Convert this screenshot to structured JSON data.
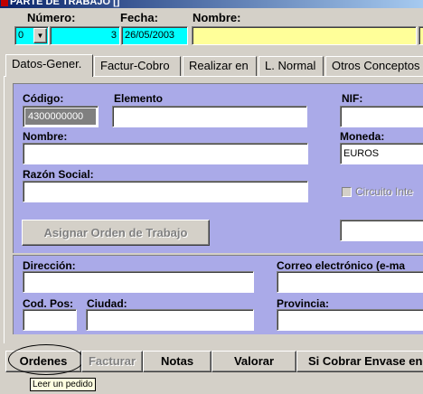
{
  "window": {
    "title": "PARTE DE TRABAJO []"
  },
  "header": {
    "numero_label": "Número:",
    "fecha_label": "Fecha:",
    "nombre_label": "Nombre:",
    "series_value": "0",
    "numero_value": "3",
    "fecha_value": "26/05/2003",
    "nombre_value": ""
  },
  "tabs": [
    {
      "label": "Datos-Gener."
    },
    {
      "label": "Factur-Cobro"
    },
    {
      "label": "Realizar en"
    },
    {
      "label": "L. Normal"
    },
    {
      "label": "Otros Conceptos"
    }
  ],
  "form": {
    "codigo_label": "Código:",
    "codigo_value": "4300000000",
    "elemento_label": "Elemento",
    "elemento_value": "",
    "nif_label": "NIF:",
    "nif_value": "",
    "nombre_label": "Nombre:",
    "nombre_value": "",
    "moneda_label": "Moneda:",
    "moneda_value": "EUROS",
    "razon_label": "Razón Social:",
    "razon_value": "",
    "circuito_label": "Circuito Inte",
    "asignar_button": "Asignar Orden de Trabajo",
    "extra_value": "",
    "direccion_label": "Dirección:",
    "direccion_value": "",
    "correo_label": "Correo electrónico (e-ma",
    "correo_value": "",
    "codpos_label": "Cod. Pos:",
    "codpos_value": "",
    "ciudad_label": "Ciudad:",
    "ciudad_value": "",
    "provincia_label": "Provincia:",
    "provincia_value": ""
  },
  "toolbar": {
    "ordenes": "Ordenes",
    "facturar": "Facturar",
    "notas": "Notas",
    "valorar": "Valorar",
    "sicobrar": "Si Cobrar Envase en"
  },
  "tooltip": {
    "text": "Leer un pedido"
  },
  "colors": {
    "titlebar": "#0a246a",
    "cyan_field": "#00ffff",
    "yellow_field": "#ffff99"
  }
}
